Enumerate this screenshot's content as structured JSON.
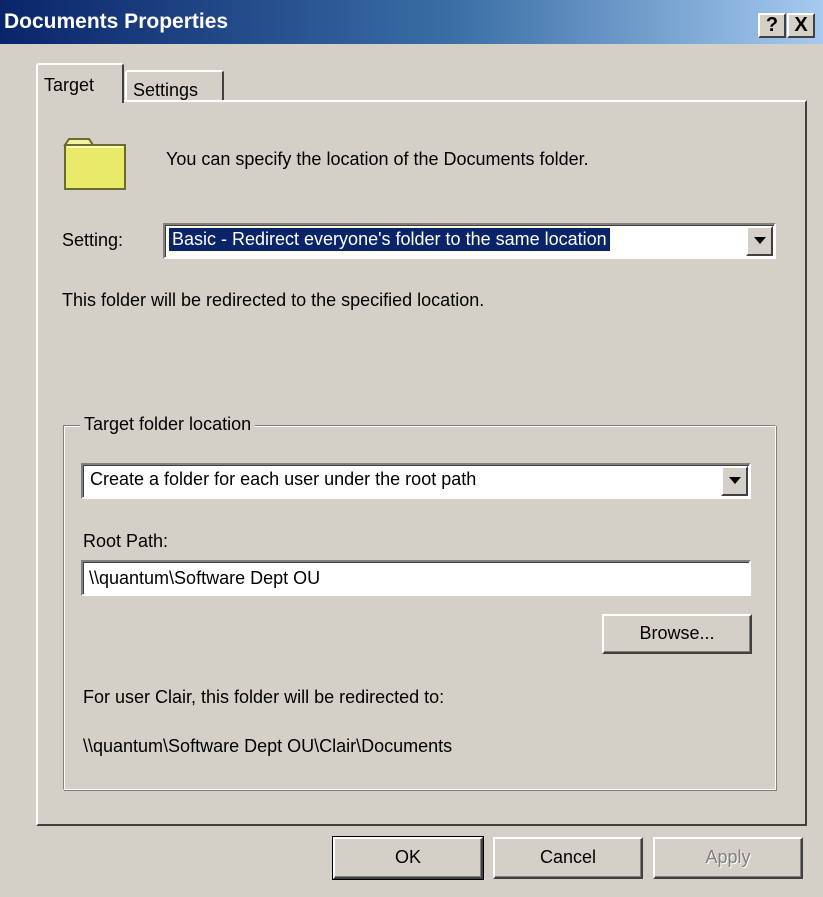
{
  "window": {
    "title": "Documents Properties",
    "help_label": "?",
    "close_label": "X"
  },
  "tabs": [
    {
      "label": "Target",
      "active": true
    },
    {
      "label": "Settings",
      "active": false
    }
  ],
  "target_tab": {
    "intro_text": "You can specify the location of the Documents folder.",
    "setting_label": "Setting:",
    "setting_value": "Basic - Redirect everyone's folder to the same location",
    "redirect_description": "This folder will be redirected to the specified location.",
    "target_group": {
      "legend": "Target folder location",
      "location_option": "Create a folder for each user under the root path",
      "root_path_label": "Root Path:",
      "root_path_value": "\\\\quantum\\Software Dept OU",
      "browse_label": "Browse...",
      "preview_label": "For user Clair, this folder will be redirected to:",
      "preview_path": "\\\\quantum\\Software Dept OU\\Clair\\Documents"
    }
  },
  "buttons": {
    "ok": "OK",
    "cancel": "Cancel",
    "apply": "Apply"
  },
  "icons": {
    "folder": "folder-icon",
    "dropdown": "chevron-down-icon"
  },
  "colors": {
    "title_start": "#0a246a",
    "title_end": "#a6caf0",
    "face": "#d4d0c8",
    "selection": "#0a246a",
    "folder_fill": "#eaea6a"
  }
}
